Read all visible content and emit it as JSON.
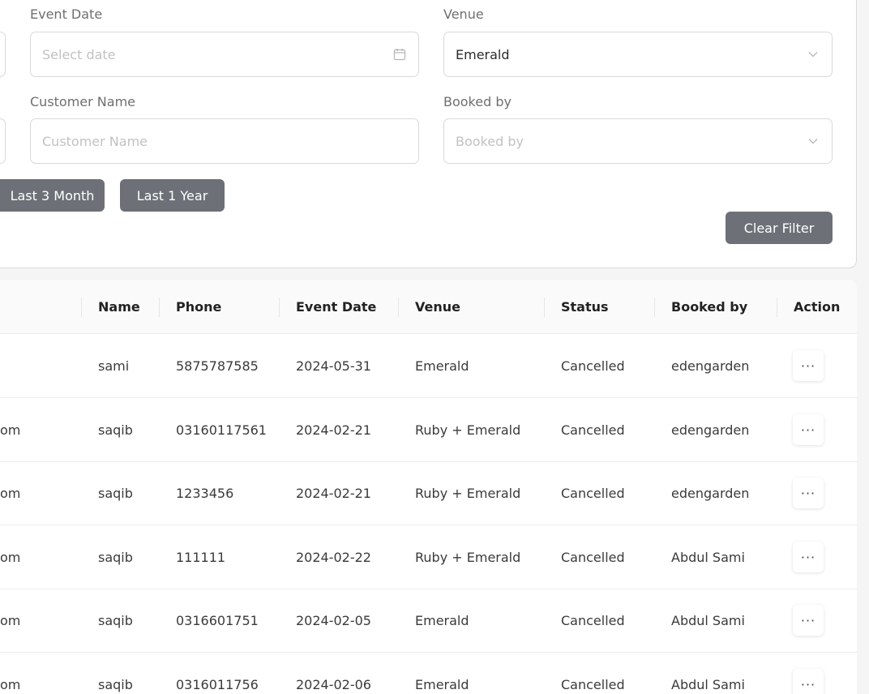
{
  "filters": {
    "event_date": {
      "label": "Event Date",
      "placeholder": "Select date",
      "icon": "calendar-icon"
    },
    "venue": {
      "label": "Venue",
      "value": "Emerald",
      "icon": "chevron-down-icon"
    },
    "customer_name": {
      "label": "Customer Name",
      "placeholder": "Customer Name"
    },
    "booked_by": {
      "label": "Booked by",
      "placeholder": "Booked by",
      "icon": "chevron-down-icon"
    },
    "quick_ranges": [
      "Last 3 Month",
      "Last 1 Year"
    ],
    "clear_label": "Clear Filter"
  },
  "table": {
    "columns": [
      "Name",
      "Phone",
      "Event Date",
      "Venue",
      "Status",
      "Booked by",
      "Action"
    ],
    "rows": [
      {
        "email_tail": "",
        "name": "sami",
        "phone": "5875787585",
        "event_date": "2024-05-31",
        "venue": "Emerald",
        "status": "Cancelled",
        "booked_by": "edengarden",
        "action": "···"
      },
      {
        "email_tail": "om",
        "name": "saqib",
        "phone": "03160117561",
        "event_date": "2024-02-21",
        "venue": "Ruby + Emerald",
        "status": "Cancelled",
        "booked_by": "edengarden",
        "action": "···"
      },
      {
        "email_tail": "om",
        "name": "saqib",
        "phone": "1233456",
        "event_date": "2024-02-21",
        "venue": "Ruby + Emerald",
        "status": "Cancelled",
        "booked_by": "edengarden",
        "action": "···"
      },
      {
        "email_tail": "om",
        "name": "saqib",
        "phone": "111111",
        "event_date": "2024-02-22",
        "venue": "Ruby + Emerald",
        "status": "Cancelled",
        "booked_by": "Abdul Sami",
        "action": "···"
      },
      {
        "email_tail": "om",
        "name": "saqib",
        "phone": "0316601751",
        "event_date": "2024-02-05",
        "venue": "Emerald",
        "status": "Cancelled",
        "booked_by": "Abdul Sami",
        "action": "···"
      },
      {
        "email_tail": "om",
        "name": "saqib",
        "phone": "0316011756",
        "event_date": "2024-02-06",
        "venue": "Emerald",
        "status": "Cancelled",
        "booked_by": "Abdul Sami",
        "action": "···"
      }
    ]
  }
}
